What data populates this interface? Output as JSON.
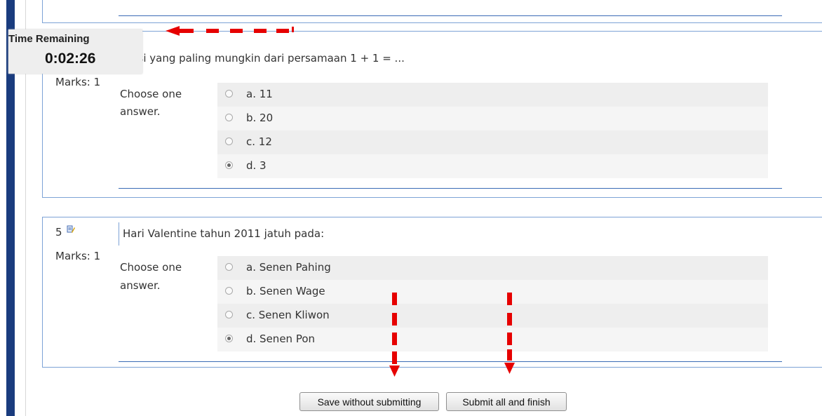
{
  "timer": {
    "title": "Time Remaining",
    "value": "0:02:26"
  },
  "q4": {
    "question_text": "usi yang paling mungkin dari persamaan 1 + 1 = ...",
    "marks": "Marks: 1",
    "choose_line1": "Choose one",
    "choose_line2": "answer.",
    "answers": [
      {
        "label": "a. 11",
        "checked": false
      },
      {
        "label": "b. 20",
        "checked": false
      },
      {
        "label": "c. 12",
        "checked": false
      },
      {
        "label": "d. 3",
        "checked": true
      }
    ]
  },
  "q5": {
    "number": "5",
    "question_text": "Hari Valentine tahun 2011 jatuh pada:",
    "marks": "Marks: 1",
    "choose_line1": "Choose one",
    "choose_line2": "answer.",
    "answers": [
      {
        "label": "a. Senen Pahing",
        "checked": false
      },
      {
        "label": "b. Senen Wage",
        "checked": false
      },
      {
        "label": "c. Senen Kliwon",
        "checked": false
      },
      {
        "label": "d. Senen Pon",
        "checked": true
      }
    ]
  },
  "buttons": {
    "save": "Save without submitting",
    "submit": "Submit all and finish"
  },
  "colors": {
    "annotation": "#e60000",
    "sidebar": "#1a3c7e",
    "border": "#7da3d6"
  }
}
